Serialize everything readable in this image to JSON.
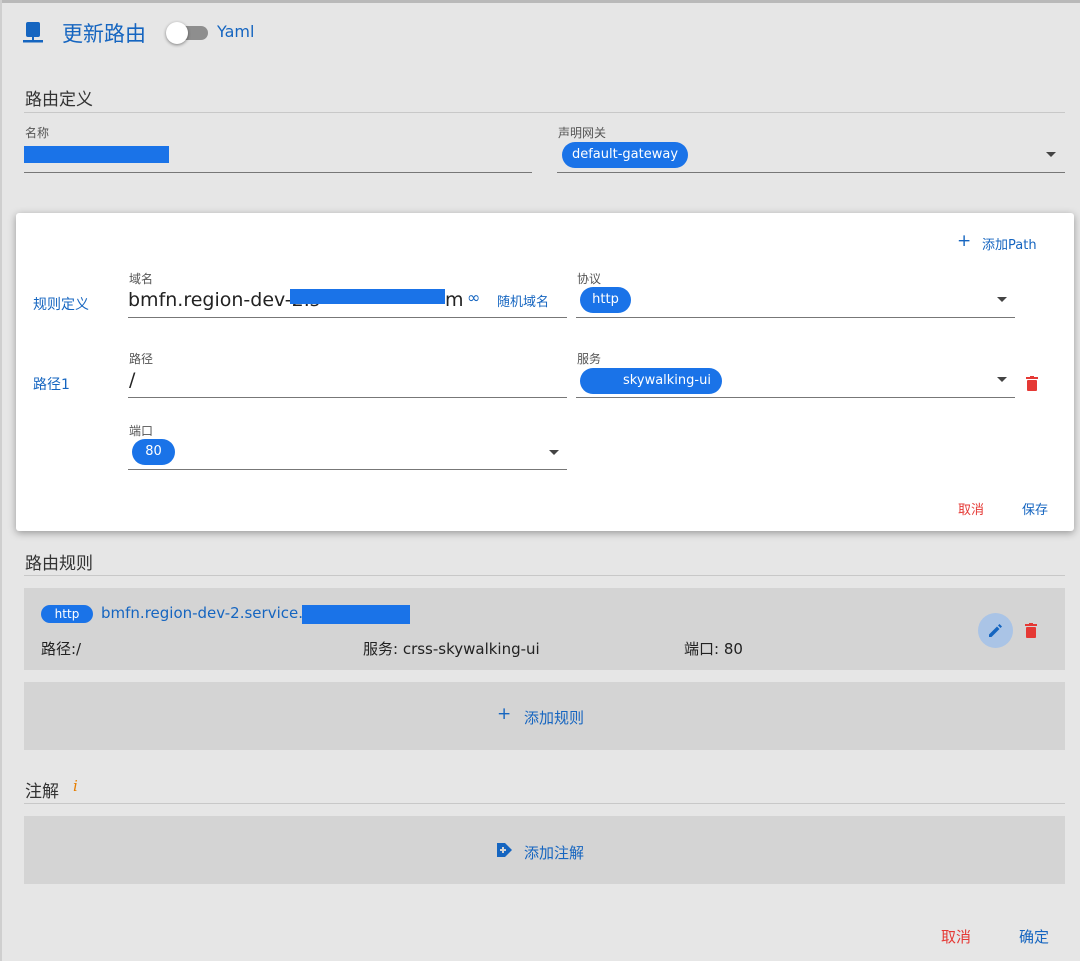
{
  "header": {
    "title": "更新路由",
    "yaml_label": "Yaml"
  },
  "route_def": {
    "heading": "路由定义",
    "name_label": "名称",
    "gateway_label": "声明网关",
    "gateway_value": "default-gateway"
  },
  "rule_editor": {
    "add_path_label": "添加Path",
    "rule_def_label": "规则定义",
    "domain_label": "域名",
    "domain_value": "bmfn.region-dev-2.s",
    "domain_tail": "m",
    "random_domain_label": "随机域名",
    "protocol_label": "协议",
    "protocol_value": "http",
    "path_section_label": "路径1",
    "path_label": "路径",
    "path_value": "/",
    "service_label": "服务",
    "service_value": "skywalking-ui",
    "port_label": "端口",
    "port_value": "80",
    "cancel_label": "取消",
    "save_label": "保存"
  },
  "route_rules": {
    "heading": "路由规则",
    "rules": [
      {
        "protocol": "http",
        "host": "bmfn.region-dev-2.service.",
        "path_text": "路径:/",
        "service_text": "服务: crss-skywalking-ui",
        "port_text": "端口: 80"
      }
    ],
    "add_rule_label": "添加规则"
  },
  "annotations": {
    "heading": "注解",
    "info_icon": "i",
    "add_label": "添加注解"
  },
  "footer": {
    "cancel_label": "取消",
    "confirm_label": "确定"
  },
  "colors": {
    "primary": "#1565c0",
    "chip": "#1a73e8",
    "danger": "#e53935",
    "info": "#e67e00"
  }
}
